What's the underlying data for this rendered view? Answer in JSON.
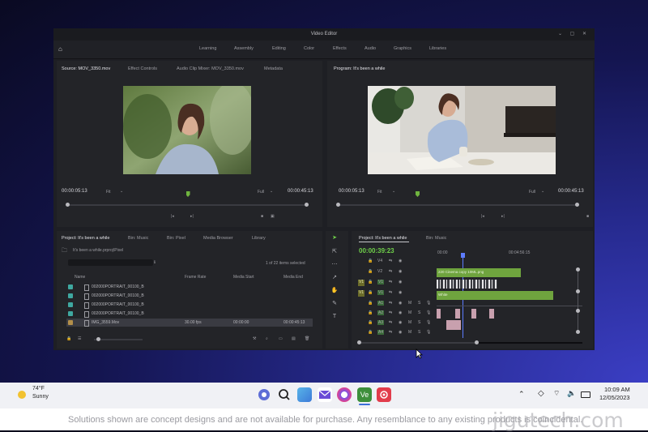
{
  "window": {
    "title": "Video Editor",
    "controls": "⌄ ▢ ✕"
  },
  "menu": [
    "Learning",
    "Assembly",
    "Editing",
    "Color",
    "Effects",
    "Audio",
    "Graphics",
    "Libraries"
  ],
  "source_panel": {
    "tabs": [
      "Source: MOV_3350.mov",
      "Effect Controls",
      "Audio Clip Mixer: MOV_3350.mov",
      "Metadata"
    ],
    "timecode_in": "00:00:05:13",
    "fit": "Fit",
    "quality": "Full",
    "timecode_out": "00:00:45:13",
    "playhead_fraction": 0.5
  },
  "program_panel": {
    "tab": "Program: It's been a while",
    "timecode_in": "00:00:05:13",
    "fit": "Fit",
    "quality": "Full",
    "timecode_out": "00:00:45:13",
    "playhead_fraction": 0.33
  },
  "project_panel": {
    "tabs": [
      "Project: It's been a while",
      "Bin: Music",
      "Bin: Pixel",
      "Media Browser",
      "Library"
    ],
    "path": "It's been a while.prproj\\Pixel",
    "search_suffix": "ℹ",
    "selection": "1 of 22 items selected",
    "columns": [
      "Name",
      "Frame Rate",
      "Media Start",
      "Media End"
    ],
    "rows": [
      {
        "name": "002000PORTRAIT_00100_B",
        "frame_rate": "",
        "start": "",
        "end": ""
      },
      {
        "name": "002000PORTRAIT_00100_B",
        "frame_rate": "",
        "start": "",
        "end": ""
      },
      {
        "name": "002000PORTRAIT_00100_B",
        "frame_rate": "",
        "start": "",
        "end": ""
      },
      {
        "name": "002000PORTRAIT_00100_B",
        "frame_rate": "",
        "start": "",
        "end": ""
      },
      {
        "name": "IMG_3559.Mov",
        "frame_rate": "30.00 fps",
        "start": "00:00:00",
        "end": "00:00:45:13"
      }
    ]
  },
  "timeline_panel": {
    "tabs": [
      "Project: It's been a while",
      "Bin: Music"
    ],
    "timecode": "00:00:39:23",
    "ruler": [
      "00:00",
      "00:04:56:15"
    ],
    "tracks": [
      "V4",
      "V2",
      "V1",
      "V1",
      "A1",
      "A2",
      "A3",
      "A4"
    ],
    "track_flags": [
      "M",
      "S"
    ],
    "clips": {
      "v2_label": "220 Cinema copy 10ML.png",
      "v1_label": "White"
    }
  },
  "taskbar": {
    "weather_temp": "74°F",
    "weather_cond": "Sunny",
    "time": "10:09 AM",
    "date": "12/05/2023",
    "ve_label": "Ve"
  },
  "footer": {
    "disclaimer": "Solutions shown are concept designs and are not available for purchase. Any resemblance to any existing products is coincidental.",
    "watermark": "jigutech.com"
  },
  "colors": {
    "accent_green": "#6fa43e",
    "timecode_green": "#6fd04a",
    "pink_clip": "#c8a0ae",
    "teal_check": "#3fa8a0"
  }
}
